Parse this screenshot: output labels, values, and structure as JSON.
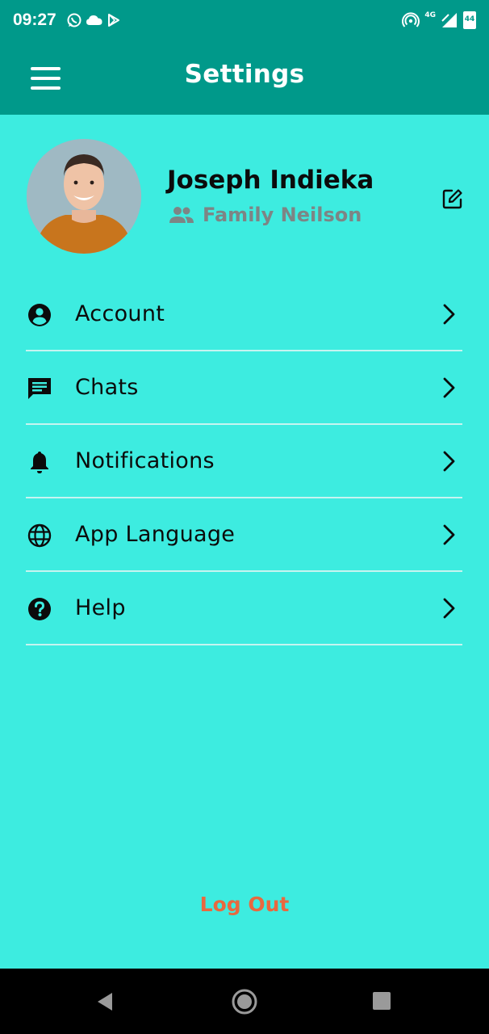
{
  "status_bar": {
    "time": "09:27",
    "network": "4G",
    "battery": "44",
    "icons_left": [
      "whatsapp-icon",
      "cloud-icon",
      "play-store-icon"
    ],
    "icons_right": [
      "hotspot-icon",
      "signal-icon",
      "battery-icon"
    ]
  },
  "app_bar": {
    "title": "Settings",
    "menu_icon": "hamburger-menu-icon"
  },
  "profile": {
    "name": "Joseph Indieka",
    "family": "Family Neilson",
    "family_icon": "group-icon",
    "edit_icon": "edit-icon"
  },
  "settings": {
    "items": [
      {
        "label": "Account",
        "icon": "account-circle-icon"
      },
      {
        "label": "Chats",
        "icon": "chat-icon"
      },
      {
        "label": "Notifications",
        "icon": "bell-icon"
      },
      {
        "label": "App Language",
        "icon": "globe-icon"
      },
      {
        "label": "Help",
        "icon": "help-circle-icon"
      }
    ]
  },
  "logout": {
    "label": "Log Out"
  },
  "colors": {
    "app_bar": "#00998a",
    "background": "#3dece0",
    "logout": "#e8693f",
    "secondary_text": "#7d8585"
  },
  "nav_bar": {
    "icons": [
      "back-icon",
      "home-icon",
      "recents-icon"
    ]
  }
}
